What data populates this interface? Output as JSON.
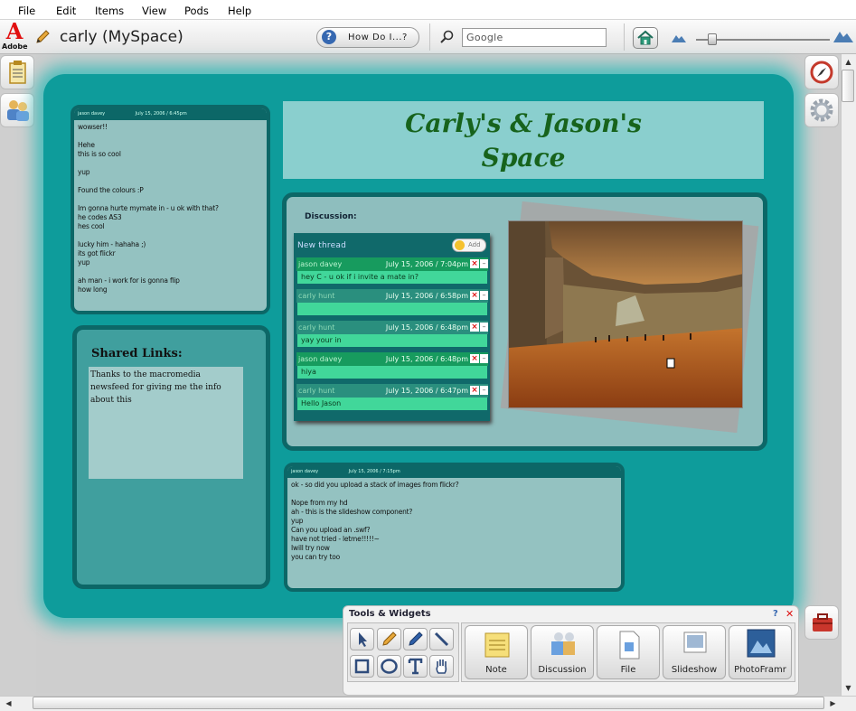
{
  "menu": {
    "file": "File",
    "edit": "Edit",
    "items": "Items",
    "view": "View",
    "pods": "Pods",
    "help": "Help"
  },
  "app": {
    "brand": "Adobe",
    "title": "carly (MySpace)"
  },
  "toolbar": {
    "howdo": "How Do I...?",
    "search_placeholder": "Google"
  },
  "banner": {
    "line1": "Carly's & Jason's",
    "line2": "Space"
  },
  "note_top": {
    "author": "jason davey",
    "date": "July 15, 2006 / 6:45pm",
    "text": "wowser!!\n\nHehe\nthis is so cool\n\nyup\n\nFound the colours :P\n\nIm gonna hurte mymate in - u ok with that?\nhe codes AS3\nhes cool\n\nlucky him - hahaha ;)\nits got flickr\nyup\n\nah man - i work for is gonna flip\nhow long"
  },
  "note_bottom": {
    "author": "jason davey",
    "date": "July 15, 2006 / 7:15pm",
    "text": "ok - so did you upload a stack of images from flickr?\n\nNope from my hd\nah - this is the slideshow component?\nyup\nCan you upload an .swf?\nhave not tried - letme!!!!!~\nIwill try now\nyou can try too"
  },
  "discussion": {
    "label": "Discussion:",
    "new_thread": "New thread",
    "add": "Add",
    "messages": [
      {
        "author": "jason davey",
        "date": "July 15, 2006 / 7:04pm",
        "text": "hey C - u ok if i invite a mate in?"
      },
      {
        "author": "carly hunt",
        "date": "July 15, 2006 / 6:58pm",
        "text": ""
      },
      {
        "author": "carly hunt",
        "date": "July 15, 2006 / 6:48pm",
        "text": "yay your in"
      },
      {
        "author": "jason davey",
        "date": "July 15, 2006 / 6:48pm",
        "text": "hiya"
      },
      {
        "author": "carly hunt",
        "date": "July 15, 2006 / 6:47pm",
        "text": "Hello Jason"
      }
    ]
  },
  "links": {
    "title": "Shared Links:",
    "text": "Thanks to the macromedia newsfeed for giving me the info about this"
  },
  "widgets": {
    "title": "Tools & Widgets",
    "help": "?",
    "close": "✕",
    "items": [
      "Note",
      "Discussion",
      "File",
      "Slideshow",
      "PhotoFramr"
    ]
  },
  "colors": {
    "teal": "#0e9c9b",
    "dark_teal": "#0c6767",
    "banner_text": "#17631c",
    "message_header": "#179b5e"
  }
}
